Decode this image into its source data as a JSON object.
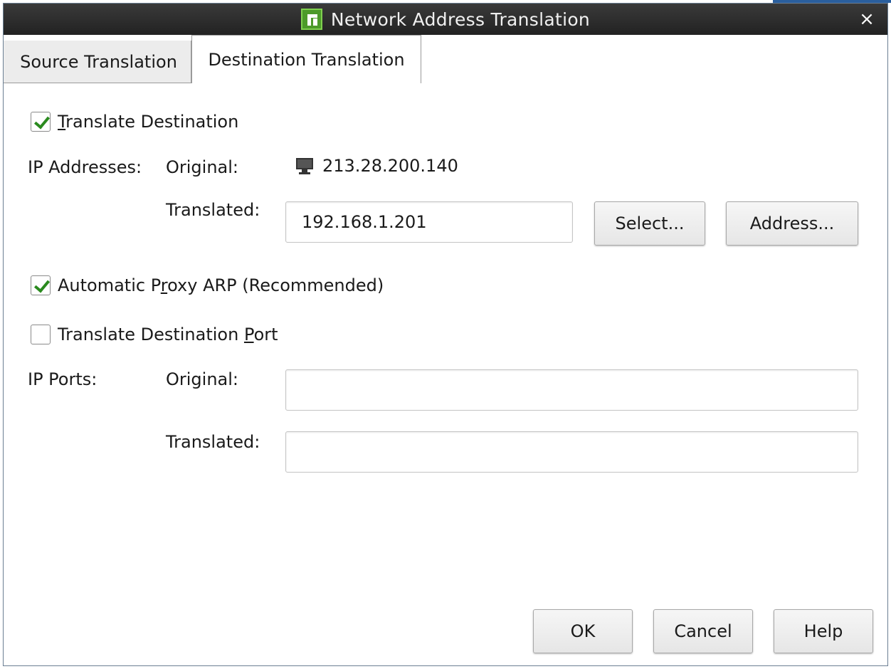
{
  "window": {
    "title": "Network Address Translation",
    "close_glyph": "×",
    "icon": "app-logo-icon"
  },
  "tabs": [
    {
      "label": "Source Translation",
      "active": false
    },
    {
      "label": "Destination Translation",
      "active": true
    }
  ],
  "form": {
    "translate_destination": {
      "label_underlined": "T",
      "label_rest": "ranslate Destination",
      "checked": true
    },
    "ip_addresses_label": "IP Addresses:",
    "original_label": "Original:",
    "original_ip": "213.28.200.140",
    "original_ip_icon": "computer-icon",
    "translated_label": "Translated:",
    "translated_ip": "192.168.1.201",
    "select_button": "Select...",
    "address_button": "Address...",
    "proxy_arp": {
      "label_before": "Automatic P",
      "label_underlined": "r",
      "label_after": "oxy ARP (Recommended)",
      "checked": true
    },
    "translate_port": {
      "label_before": "Translate Destination ",
      "label_underlined": "P",
      "label_after": "ort",
      "checked": false
    },
    "ip_ports_label": "IP Ports:",
    "port_original_label": "Original:",
    "port_original_value": "",
    "port_translated_label": "Translated:",
    "port_translated_value": ""
  },
  "buttons": {
    "ok": "OK",
    "cancel": "Cancel",
    "help": "Help"
  },
  "colors": {
    "titlebar": "#2a2a2a",
    "check_mark": "#2a8a1e",
    "app_icon": "#4c9a2a"
  }
}
